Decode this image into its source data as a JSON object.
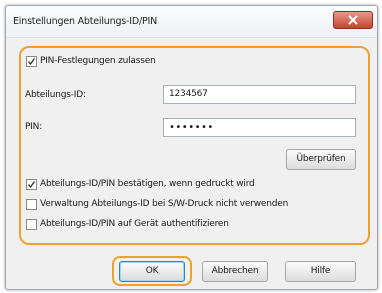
{
  "window": {
    "title": "Einstellungen Abteilungs-ID/PIN"
  },
  "settings": {
    "pin_checkbox": {
      "label": "PIN-Festlegungen zulassen",
      "checked": true
    },
    "dept_id": {
      "label": "Abteilungs-ID:",
      "value": "1234567"
    },
    "pin": {
      "label": "PIN:",
      "value": "•••••••"
    },
    "verify_label": "Überprüfen",
    "options": [
      {
        "label": "Abteilungs-ID/PIN bestätigen, wenn gedruckt wird",
        "checked": true
      },
      {
        "label": "Verwaltung Abteilungs-ID bei S/W-Druck nicht verwenden",
        "checked": false
      },
      {
        "label": "Abteilungs-ID/PIN auf Gerät authentifizieren",
        "checked": false
      }
    ]
  },
  "buttons": {
    "ok": "OK",
    "cancel": "Abbrechen",
    "help": "Hilfe"
  },
  "colors": {
    "highlight": "#f0a030",
    "close_button": "#c9432e"
  }
}
